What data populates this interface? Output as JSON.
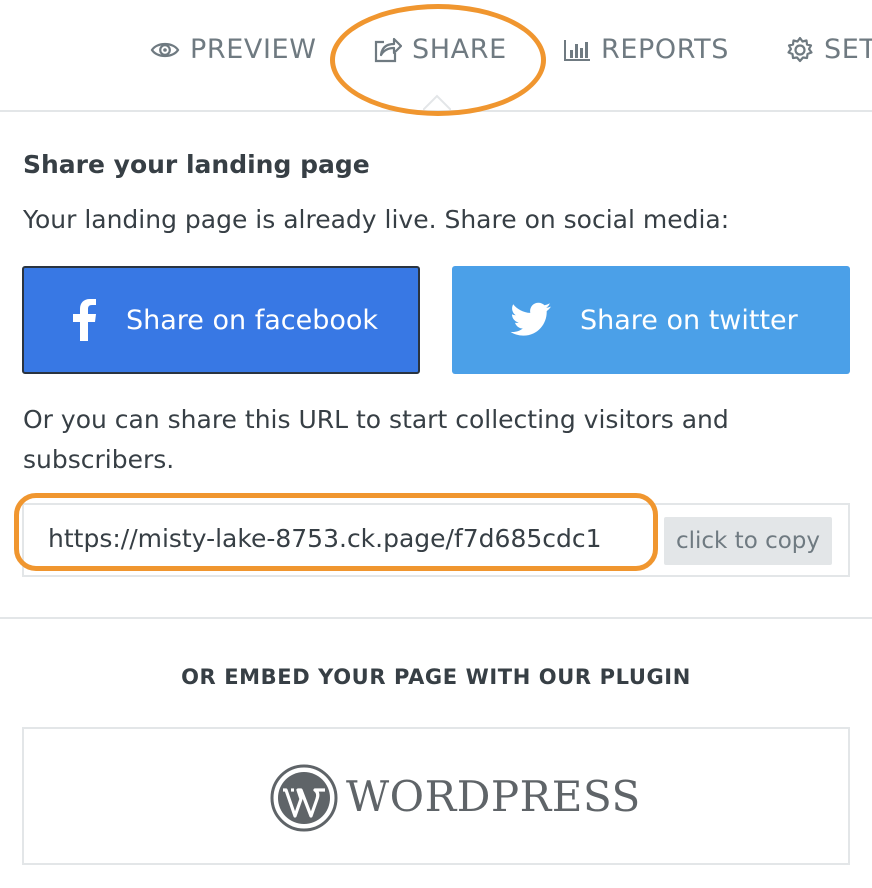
{
  "nav": {
    "tabs": [
      {
        "label": "PREVIEW",
        "icon": "eye-icon"
      },
      {
        "label": "SHARE",
        "icon": "share-icon",
        "active": true
      },
      {
        "label": "REPORTS",
        "icon": "bar-chart-icon"
      },
      {
        "label": "SETT",
        "icon": "gear-icon"
      }
    ]
  },
  "share": {
    "heading": "Share your landing page",
    "intro": "Your landing page is already live. Share on social media:",
    "facebook_label": "Share on facebook",
    "twitter_label": "Share on twitter",
    "url_description": "Or you can share this URL to start collecting visitors and subscribers.",
    "url": "https://misty-lake-8753.ck.page/f7d685cdc1",
    "copy_label": "click to copy"
  },
  "embed": {
    "title": "OR EMBED YOUR PAGE WITH OUR PLUGIN",
    "plugin_name": "WordPress",
    "logo_text": "WORDPRESS"
  },
  "colors": {
    "facebook": "#3878e4",
    "twitter": "#4ba0e8",
    "highlight": "#f0962f",
    "text": "#373f45",
    "muted": "#6f7a81"
  }
}
